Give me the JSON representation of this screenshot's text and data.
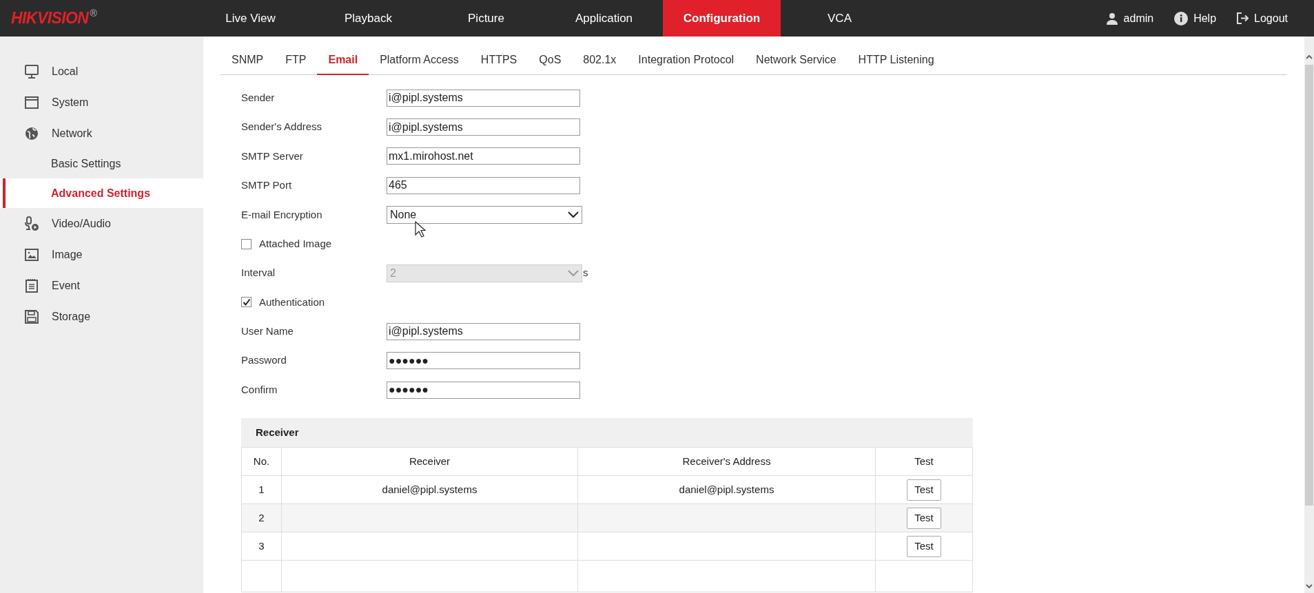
{
  "header": {
    "logo": "HIKVISION",
    "logo_mark": "®",
    "nav": [
      {
        "label": "Live View",
        "selected": false
      },
      {
        "label": "Playback",
        "selected": false
      },
      {
        "label": "Picture",
        "selected": false
      },
      {
        "label": "Application",
        "selected": false
      },
      {
        "label": "Configuration",
        "selected": true
      },
      {
        "label": "VCA",
        "selected": false
      }
    ],
    "user": "admin",
    "help": "Help",
    "logout": "Logout"
  },
  "sidebar": {
    "items": [
      {
        "label": "Local",
        "selected": false
      },
      {
        "label": "System",
        "selected": false
      },
      {
        "label": "Network",
        "selected": false,
        "children": [
          {
            "label": "Basic Settings",
            "selected": false
          },
          {
            "label": "Advanced Settings",
            "selected": true
          }
        ]
      },
      {
        "label": "Video/Audio",
        "selected": false
      },
      {
        "label": "Image",
        "selected": false
      },
      {
        "label": "Event",
        "selected": false
      },
      {
        "label": "Storage",
        "selected": false
      }
    ]
  },
  "tabs": [
    {
      "label": "SNMP",
      "selected": false
    },
    {
      "label": "FTP",
      "selected": false
    },
    {
      "label": "Email",
      "selected": true
    },
    {
      "label": "Platform Access",
      "selected": false
    },
    {
      "label": "HTTPS",
      "selected": false
    },
    {
      "label": "QoS",
      "selected": false
    },
    {
      "label": "802.1x",
      "selected": false
    },
    {
      "label": "Integration Protocol",
      "selected": false
    },
    {
      "label": "Network Service",
      "selected": false
    },
    {
      "label": "HTTP Listening",
      "selected": false
    }
  ],
  "form": {
    "fields": [
      {
        "kind": "text",
        "label": "Sender",
        "value": "i@pipl.systems"
      },
      {
        "kind": "text",
        "label": "Sender's Address",
        "value": "i@pipl.systems"
      },
      {
        "kind": "text",
        "label": "SMTP Server",
        "value": "mx1.mirohost.net"
      },
      {
        "kind": "text",
        "label": "SMTP Port",
        "value": "465"
      },
      {
        "kind": "select",
        "label": "E-mail Encryption",
        "value": "None",
        "disabled": false
      },
      {
        "kind": "checkbox",
        "label": "Attached Image",
        "checked": false
      },
      {
        "kind": "select",
        "label": "Interval",
        "value": "2",
        "disabled": true,
        "suffix": "s"
      },
      {
        "kind": "checkbox",
        "label": "Authentication",
        "checked": true
      },
      {
        "kind": "text",
        "label": "User Name",
        "value": "i@pipl.systems"
      },
      {
        "kind": "text",
        "label": "Password",
        "value": "●●●●●●"
      },
      {
        "kind": "text",
        "label": "Confirm",
        "value": "●●●●●●"
      }
    ]
  },
  "receiver": {
    "title": "Receiver",
    "columns": [
      "No.",
      "Receiver",
      "Receiver's Address",
      "Test"
    ],
    "rows": [
      {
        "no": "1",
        "receiver": "daniel@pipl.systems",
        "address": "daniel@pipl.systems",
        "test": "Test"
      },
      {
        "no": "2",
        "test": "Test"
      },
      {
        "no": "3",
        "test": "Test"
      }
    ]
  }
}
